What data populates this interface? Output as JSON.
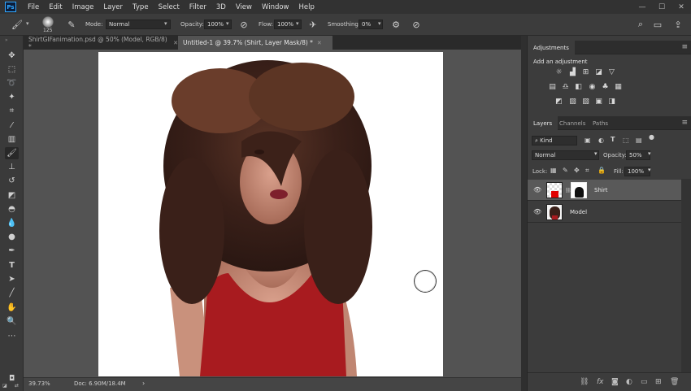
{
  "app": {
    "logo": "Ps",
    "menu": [
      "File",
      "Edit",
      "Image",
      "Layer",
      "Type",
      "Select",
      "Filter",
      "3D",
      "View",
      "Window",
      "Help"
    ],
    "window_controls": [
      "minimize-icon",
      "maximize-icon",
      "close-icon"
    ]
  },
  "options": {
    "brush_size": "125",
    "mode_label": "Mode:",
    "mode_value": "Normal",
    "opacity_label": "Opacity:",
    "opacity_value": "100%",
    "flow_label": "Flow:",
    "flow_value": "100%",
    "smoothing_label": "Smoothing:",
    "smoothing_value": "0%"
  },
  "tabs": [
    {
      "label": "ShirtGIFanimation.psd @ 50% (Model, RGB/8) *",
      "active": false
    },
    {
      "label": "Untitled-1 @ 39.7% (Shirt, Layer Mask/8) *",
      "active": true
    }
  ],
  "tools": [
    "move-tool-icon",
    "marquee-tool-icon",
    "lasso-tool-icon",
    "magic-wand-icon",
    "crop-tool-icon",
    "eyedropper-icon",
    "healing-brush-icon",
    "brush-tool-icon",
    "clone-stamp-icon",
    "history-brush-icon",
    "eraser-icon",
    "paint-bucket-icon",
    "blur-tool-icon",
    "dodge-tool-icon",
    "pen-tool-icon",
    "type-tool-icon",
    "path-select-icon",
    "line-tool-icon",
    "hand-tool-icon",
    "zoom-tool-icon",
    "more-tools-icon"
  ],
  "status": {
    "zoom": "39.73%",
    "doc": "Doc: 6.90M/18.4M"
  },
  "adjustments": {
    "tab": "Adjustments",
    "subtitle": "Add an adjustment"
  },
  "layers_panel": {
    "tabs": [
      "Layers",
      "Channels",
      "Paths"
    ],
    "filter_kind": "Kind",
    "blend_mode": "Normal",
    "opacity_label": "Opacity:",
    "opacity_value": "50%",
    "lock_label": "Lock:",
    "fill_label": "Fill:",
    "fill_value": "100%",
    "layers": [
      {
        "name": "Shirt",
        "selected": true
      },
      {
        "name": "Model",
        "selected": false
      }
    ]
  },
  "colors": {
    "foreground": "#000000",
    "background": "#ffffff",
    "shirt": "#a81b1f"
  }
}
